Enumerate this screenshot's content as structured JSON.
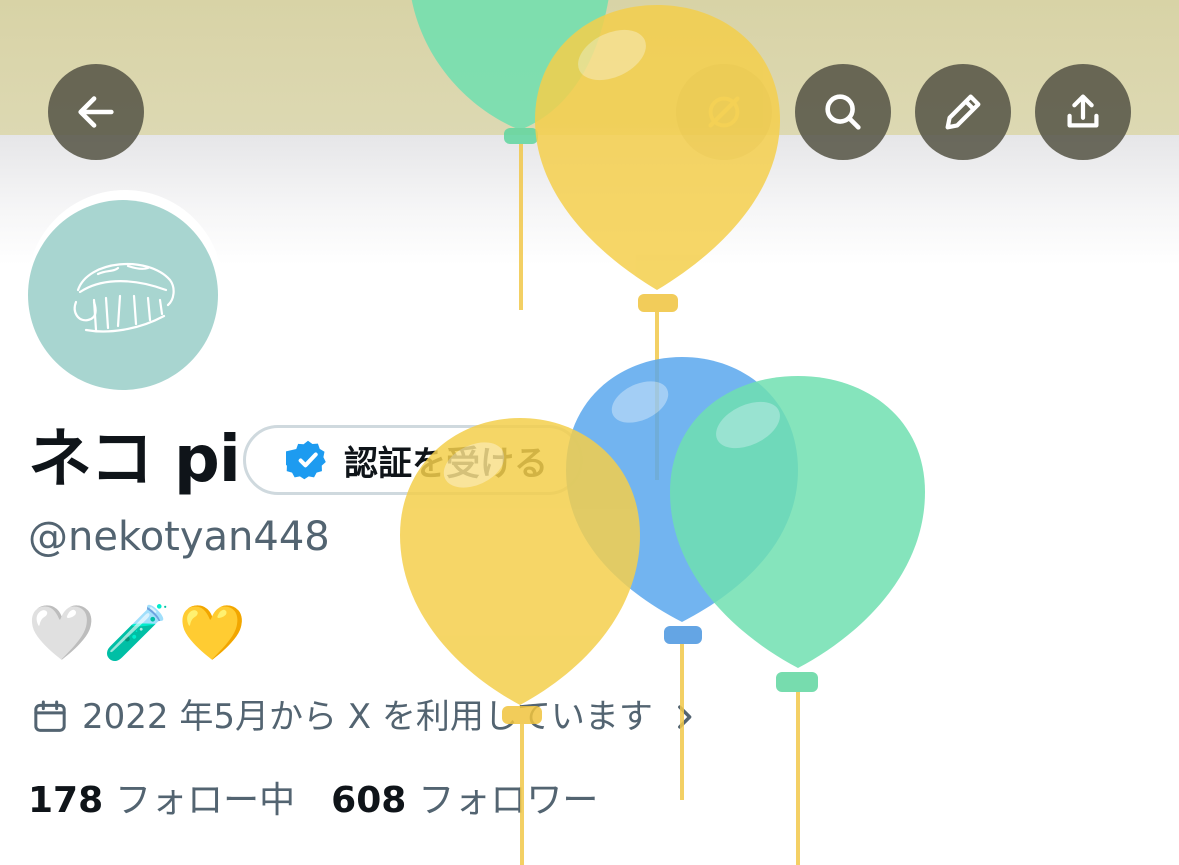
{
  "profile": {
    "display_name": "ネコ pi",
    "verify_label": "認証を受ける",
    "handle": "@nekotyan448",
    "bio": [
      "🤍",
      "🧪",
      "💛"
    ],
    "joined": "2022 年5月から X を利用しています",
    "following_count": "178",
    "following_label": "フォロー中",
    "followers_count": "608",
    "followers_label": "フォロワー"
  },
  "nav": {
    "back": "arrow-left-icon",
    "grok": "grok-icon",
    "search": "search-icon",
    "edit": "pencil-icon",
    "share": "share-icon"
  },
  "colors": {
    "banner": "#d8d3a6",
    "avatar": "#a8d5d0",
    "verified_blue": "#1d9bf0",
    "secondary_text": "#536471",
    "balloon_yellow": "#f4cf4c",
    "balloon_blue": "#5aa8ee",
    "balloon_green": "#6fe0b0"
  }
}
